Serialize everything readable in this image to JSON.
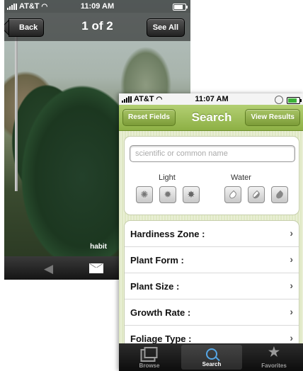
{
  "photo_viewer": {
    "carrier": "AT&T",
    "time": "11:09 AM",
    "back_label": "Back",
    "title": "1 of 2",
    "see_all_label": "See All",
    "caption": "habit"
  },
  "search_screen": {
    "carrier": "AT&T",
    "time": "11:07 AM",
    "reset_label": "Reset Fields",
    "title": "Search",
    "view_results_label": "View Results",
    "search_placeholder": "scientific or common name",
    "light_label": "Light",
    "water_label": "Water",
    "filters": [
      {
        "label": "Hardiness Zone :"
      },
      {
        "label": "Plant Form :"
      },
      {
        "label": "Plant Size :"
      },
      {
        "label": "Growth Rate :"
      },
      {
        "label": "Foliage Type :"
      }
    ],
    "tabs": [
      {
        "label": "Browse",
        "icon": "browse-icon"
      },
      {
        "label": "Search",
        "icon": "search-icon",
        "active": true
      },
      {
        "label": "Favorites",
        "icon": "star-icon"
      }
    ]
  },
  "colors": {
    "nav_green": "#99b852",
    "tab_active_blue": "#55a7e6",
    "content_bg": "#e4ebcc"
  }
}
